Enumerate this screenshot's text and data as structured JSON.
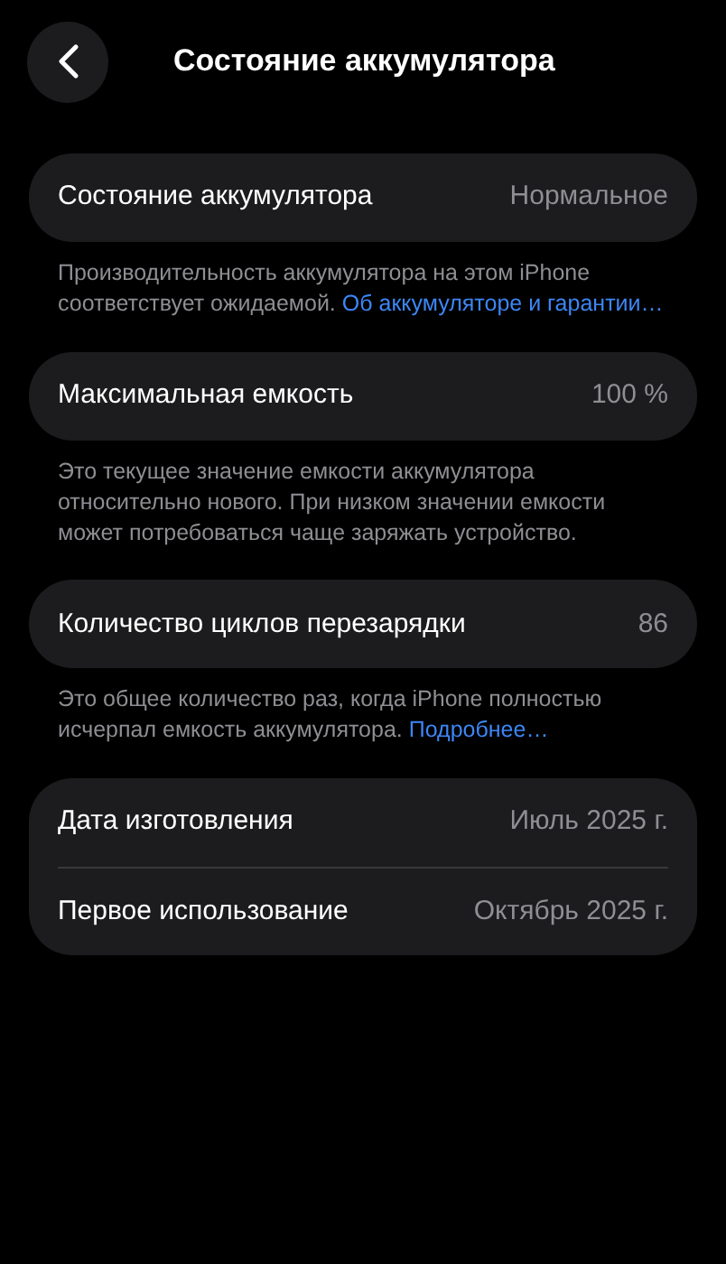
{
  "header": {
    "title": "Состояние аккумулятора"
  },
  "sections": [
    {
      "rows": [
        {
          "label": "Состояние аккумулятора",
          "value": "Нормальное"
        }
      ],
      "footer": {
        "text": "Производительность аккумулятора на этом iPhone соответствует ожидаемой.",
        "link": "Об аккумуляторе и гарантии…"
      }
    },
    {
      "rows": [
        {
          "label": "Максимальная емкость",
          "value": "100 %"
        }
      ],
      "footer": {
        "text": "Это текущее значение емкости аккумулятора относительно нового. При низком значении емкости может потребоваться чаще заряжать устройство."
      }
    },
    {
      "rows": [
        {
          "label": "Количество циклов перезарядки",
          "value": "86"
        }
      ],
      "footer": {
        "text": "Это общее количество раз, когда iPhone полностью исчерпал емкость аккумулятора.",
        "link": "Подробнее…"
      }
    },
    {
      "rows": [
        {
          "label": "Дата изготовления",
          "value": "Июль 2025 г."
        },
        {
          "label": "Первое использование",
          "value": "Октябрь 2025 г."
        }
      ]
    }
  ]
}
